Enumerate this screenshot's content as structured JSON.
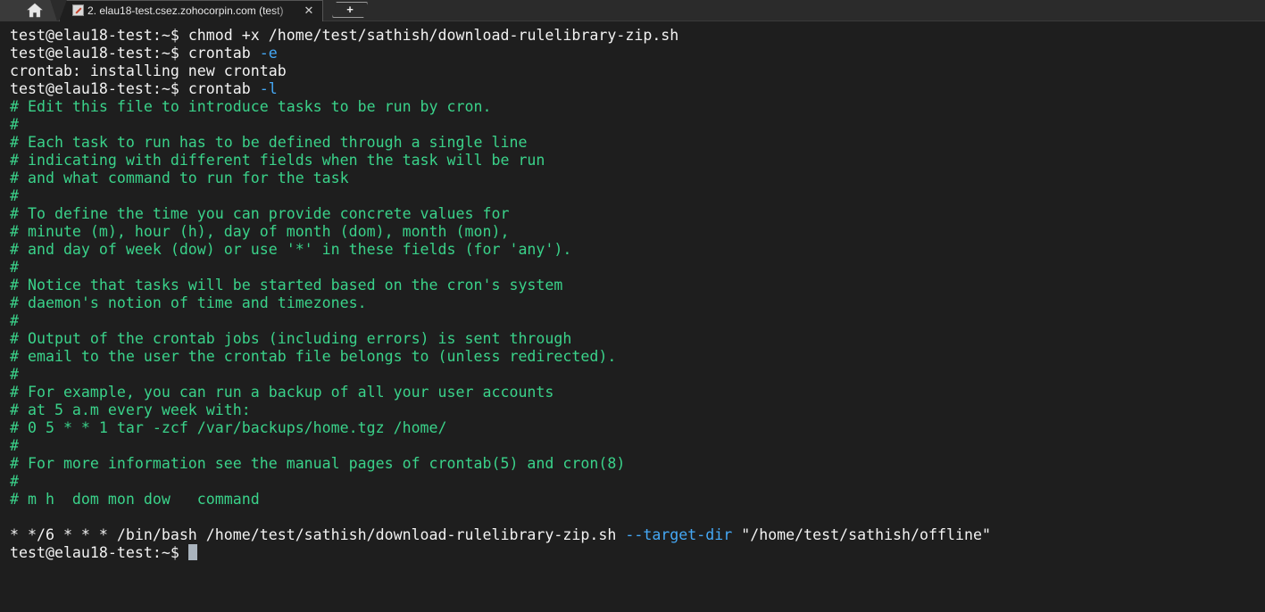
{
  "tabs": {
    "home_icon": "home-icon",
    "session_title": "2. elau18-test.csez.zohocorpin.com (test)",
    "session_icon": "terminal-session-icon",
    "close_glyph": "✕",
    "new_tab_glyph": "+"
  },
  "colors": {
    "background": "#1e1e1e",
    "text": "#f2f2f2",
    "comment": "#3ad28a",
    "option": "#45a8f5"
  },
  "terminal": {
    "prompt": "test@elau18-test:~$",
    "line1": {
      "cmd": " chmod +x /home/test/sathish/download-rulelibrary-zip.sh"
    },
    "line2": {
      "cmd": " crontab ",
      "flag": "-e"
    },
    "line3": {
      "text": "crontab: installing new crontab"
    },
    "line4": {
      "cmd": " crontab ",
      "flag": "-l"
    },
    "comments": [
      "# Edit this file to introduce tasks to be run by cron.",
      "#",
      "# Each task to run has to be defined through a single line",
      "# indicating with different fields when the task will be run",
      "# and what command to run for the task",
      "#",
      "# To define the time you can provide concrete values for",
      "# minute (m), hour (h), day of month (dom), month (mon),",
      "# and day of week (dow) or use '*' in these fields (for 'any').",
      "#",
      "# Notice that tasks will be started based on the cron's system",
      "# daemon's notion of time and timezones.",
      "#",
      "# Output of the crontab jobs (including errors) is sent through",
      "# email to the user the crontab file belongs to (unless redirected).",
      "#",
      "# For example, you can run a backup of all your user accounts",
      "# at 5 a.m every week with:",
      "# 0 5 * * 1 tar -zcf /var/backups/home.tgz /home/",
      "#",
      "# For more information see the manual pages of crontab(5) and cron(8)",
      "#",
      "# m h  dom mon dow   command"
    ],
    "cron_entry": {
      "pre": "* */6 * * * /bin/bash /home/test/sathish/download-rulelibrary-zip.sh ",
      "flag": "--target-dir",
      "post": " \"/home/test/sathish/offline\""
    }
  }
}
